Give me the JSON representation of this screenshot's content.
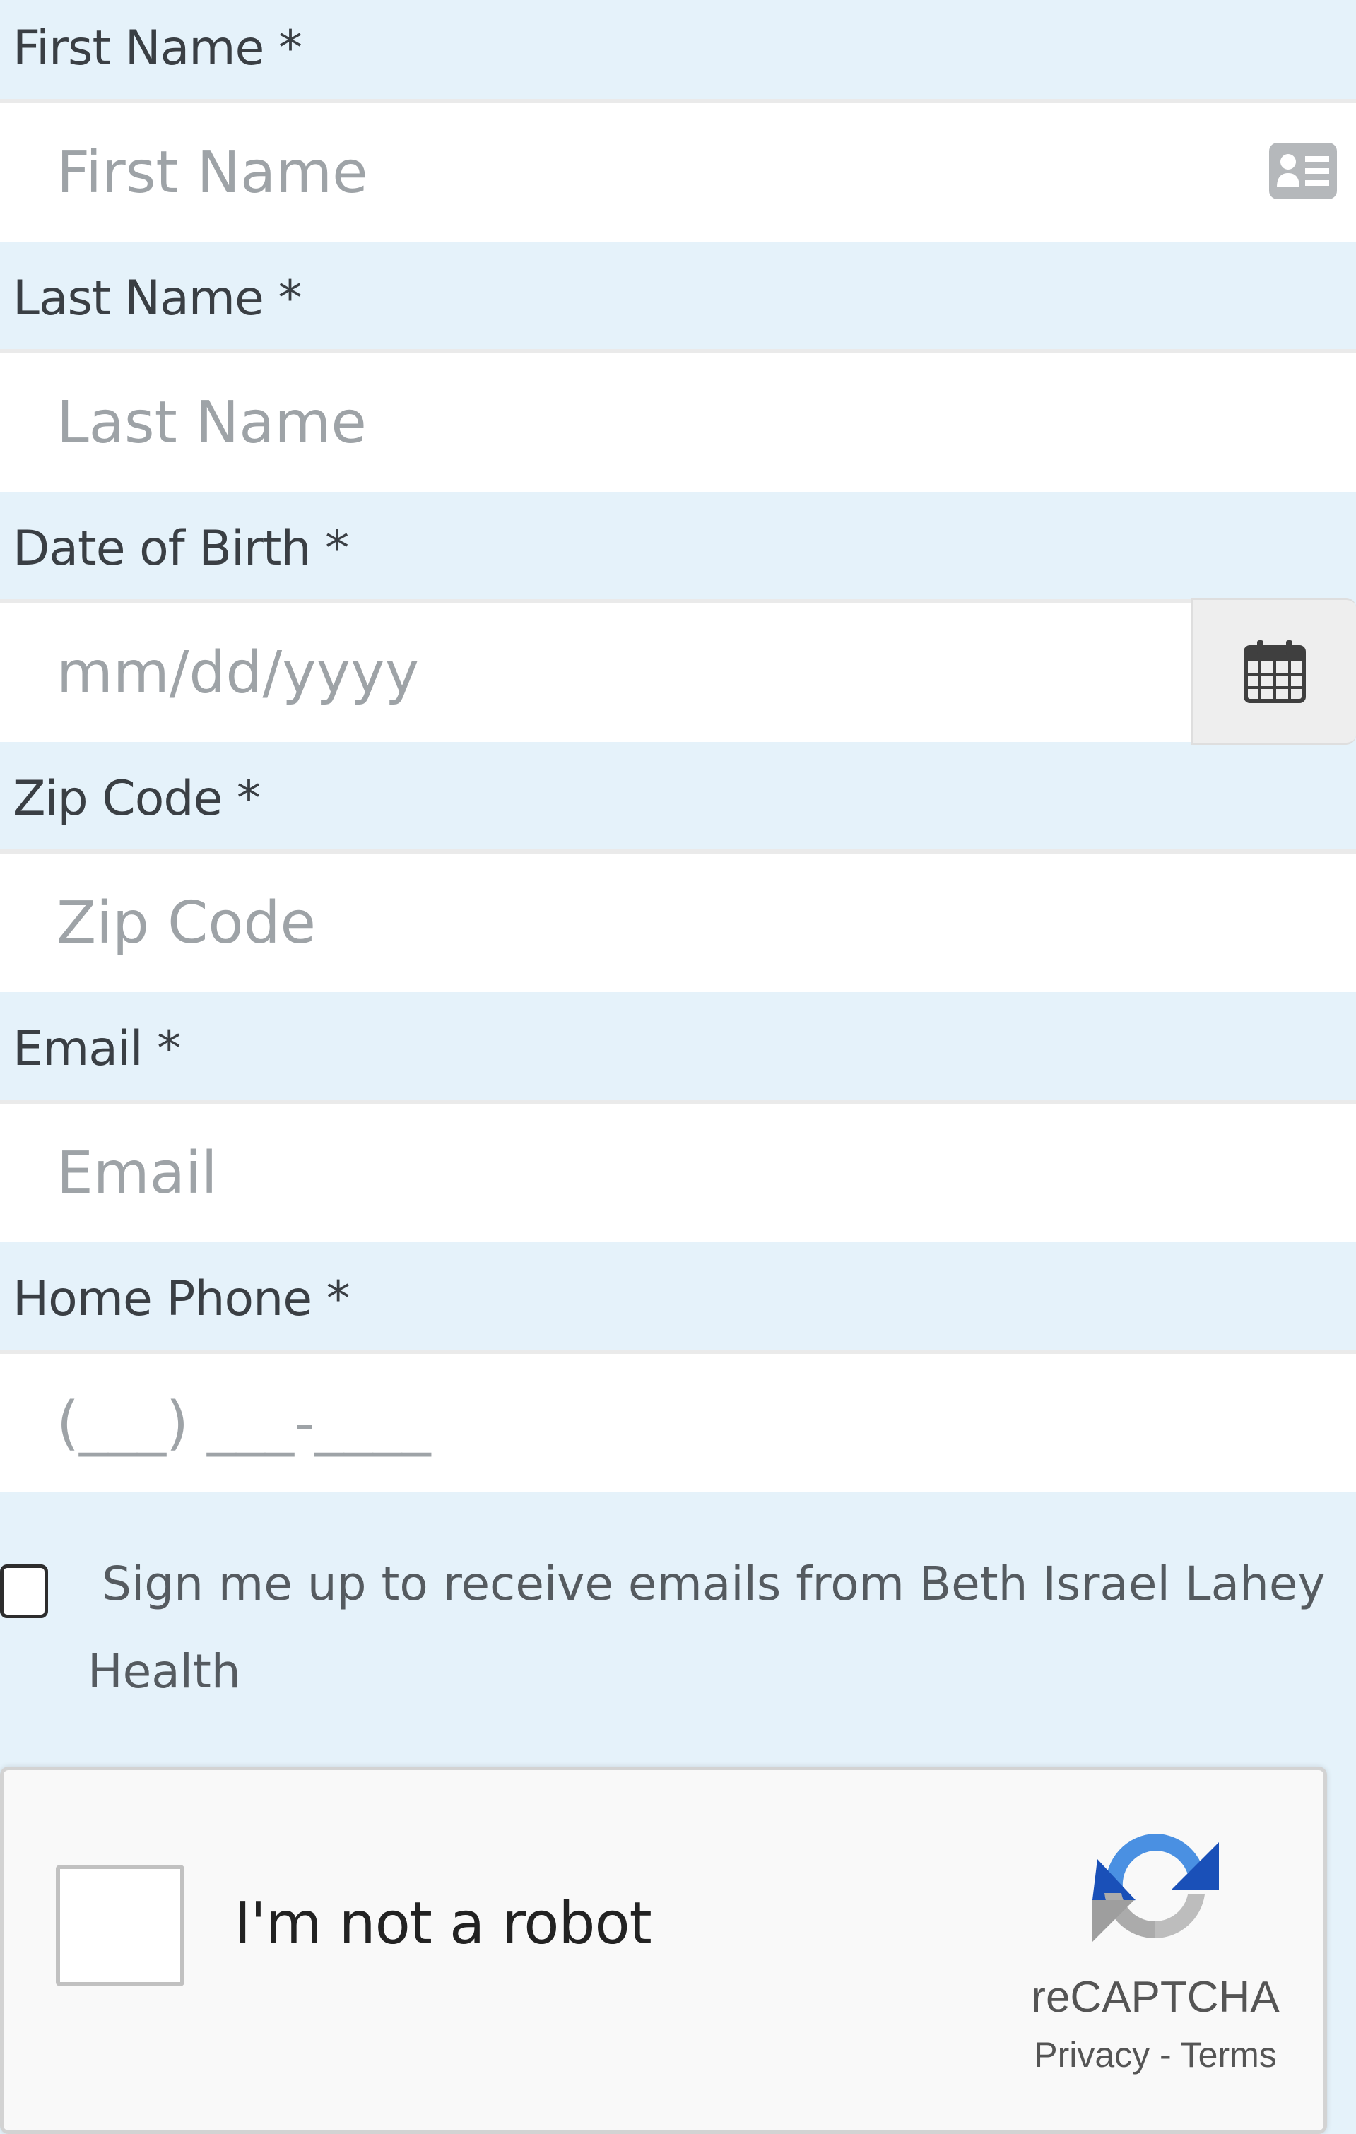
{
  "form": {
    "first_name": {
      "label": "First Name *",
      "placeholder": "First Name"
    },
    "last_name": {
      "label": "Last Name *",
      "placeholder": "Last Name"
    },
    "dob": {
      "label": "Date of Birth *",
      "placeholder": "mm/dd/yyyy"
    },
    "zip": {
      "label": "Zip Code *",
      "placeholder": "Zip Code"
    },
    "email": {
      "label": "Email *",
      "placeholder": "Email"
    },
    "phone": {
      "label": "Home Phone *",
      "placeholder": "(___) ___-____"
    },
    "signup": {
      "text": "Sign me up to receive emails from Beth Israel Lahey Health",
      "checked": false
    }
  },
  "recaptcha": {
    "label": "I'm not a robot",
    "brand": "reCAPTCHA",
    "privacy": "Privacy",
    "separator": " - ",
    "terms": "Terms"
  },
  "icons": {
    "contact_card": "contact-card-icon",
    "calendar": "calendar-icon",
    "recaptcha_logo": "recaptcha-logo-icon"
  },
  "colors": {
    "background": "#e5f2fa",
    "input_bg": "#ffffff",
    "label_text": "#3a3f44",
    "placeholder": "#9ea3a7"
  }
}
